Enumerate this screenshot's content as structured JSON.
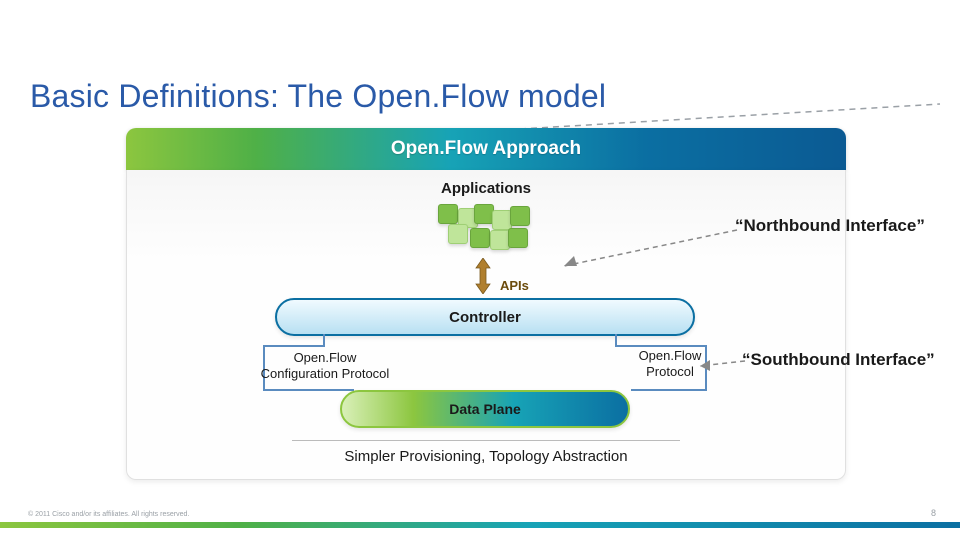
{
  "title": "Basic Definitions: The Open.Flow model",
  "banner": "Open.Flow Approach",
  "labels": {
    "applications": "Applications",
    "apis": "APIs",
    "controller": "Controller",
    "of_config_line1": "Open.Flow",
    "of_config_line2": "Configuration Protocol",
    "of_proto_line1": "Open.Flow",
    "of_proto_line2": "Protocol",
    "data_plane": "Data Plane",
    "caption": "Simpler Provisioning, Topology Abstraction",
    "northbound": "“Northbound Interface”",
    "southbound": "“Southbound Interface”"
  },
  "footer": {
    "copyright": "© 2011 Cisco and/or its affiliates. All rights reserved.",
    "page": "8"
  },
  "colors": {
    "title": "#2a5aa8",
    "accent_blue": "#0b6fa2",
    "accent_green": "#8cc63f",
    "arrow_gray": "#888888"
  }
}
